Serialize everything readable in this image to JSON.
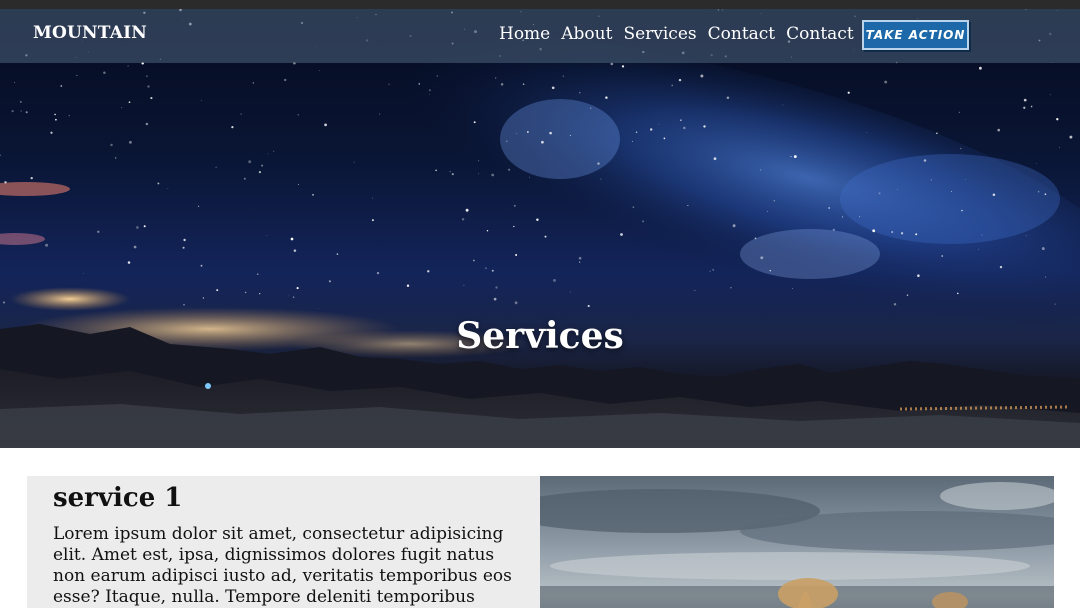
{
  "navbar": {
    "brand": "MOUNTAIN",
    "links": [
      {
        "label": "Home"
      },
      {
        "label": "About"
      },
      {
        "label": "Services"
      },
      {
        "label": "Contact"
      },
      {
        "label": "Contact"
      }
    ],
    "cta_label": "TAKE ACTION"
  },
  "hero": {
    "title": "Services"
  },
  "services": [
    {
      "heading": "service 1",
      "body": "Lorem ipsum dolor sit amet, consectetur adipisicing elit. Amet est, ipsa, dignissimos dolores fugit natus non earum adipisci iusto ad, veritatis temporibus eos esse? Itaque, nulla. Tempore deleniti temporibus fugiat sed"
    }
  ],
  "colors": {
    "navbar_bg": "#465a73",
    "cta_bg": "#1d68a8",
    "card_bg": "#ececec",
    "night_sky": "#0a1636"
  }
}
